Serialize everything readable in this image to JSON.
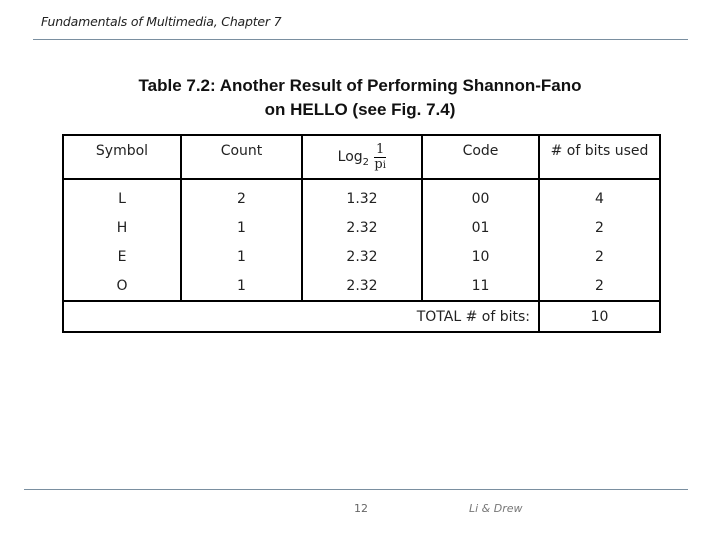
{
  "header": {
    "text": "Fundamentals of Multimedia, Chapter 7"
  },
  "title": {
    "line1": "Table 7.2: Another Result of Performing Shannon-Fano",
    "line2": "on HELLO (see Fig. 7.4)"
  },
  "table": {
    "headers": {
      "symbol": "Symbol",
      "count": "Count",
      "log_prefix": "Log",
      "log_sub": "2",
      "frac_num": "1",
      "frac_den": "p",
      "frac_den_sub": "i",
      "code": "Code",
      "bits": "# of bits used"
    },
    "rows": [
      {
        "symbol": "L",
        "count": "2",
        "log": "1.32",
        "code": "00",
        "bits": "4"
      },
      {
        "symbol": "H",
        "count": "1",
        "log": "2.32",
        "code": "01",
        "bits": "2"
      },
      {
        "symbol": "E",
        "count": "1",
        "log": "2.32",
        "code": "10",
        "bits": "2"
      },
      {
        "symbol": "O",
        "count": "1",
        "log": "2.32",
        "code": "11",
        "bits": "2"
      }
    ],
    "total_label": "TOTAL # of bits:",
    "total_value": "10"
  },
  "footer": {
    "page": "12",
    "authors": "Li & Drew"
  }
}
